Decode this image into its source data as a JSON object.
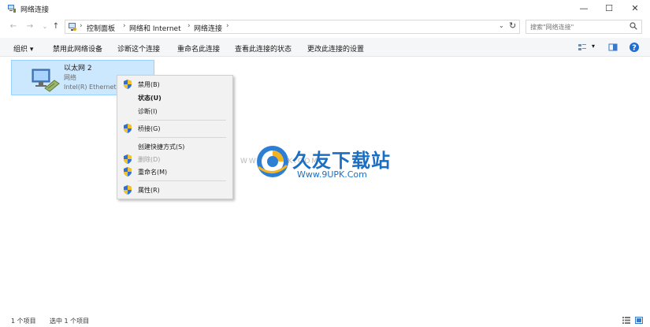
{
  "window": {
    "title": "网络连接",
    "minimize": "—",
    "maximize": "☐",
    "close": "✕"
  },
  "nav": {
    "back": "←",
    "forward": "→",
    "recent": "⌄",
    "up": "↑"
  },
  "address": {
    "crumbs": [
      "控制面板",
      "网络和 Internet",
      "网络连接"
    ],
    "separator": "›",
    "dropdown": "⌄",
    "refresh": "↻"
  },
  "search": {
    "placeholder": "搜索\"网络连接\""
  },
  "toolbar": {
    "organize": "组织 ▾",
    "disable": "禁用此网络设备",
    "diagnose": "诊断这个连接",
    "rename": "重命名此连接",
    "view_status": "查看此连接的状态",
    "change_settings": "更改此连接的设置",
    "view_options_arrow": "▾",
    "help": "?"
  },
  "connection": {
    "name": "以太网 2",
    "status": "网络",
    "adapter": "Intel(R) Ethernet"
  },
  "context_menu": {
    "disable": "禁用(B)",
    "status": "状态(U)",
    "diagnose": "诊断(I)",
    "bridge": "桥接(G)",
    "shortcut": "创建快捷方式(S)",
    "delete": "删除(D)",
    "rename": "重命名(M)",
    "properties": "属性(R)"
  },
  "watermark": {
    "title": "久友下载站",
    "url": "Www.9UPK.Com",
    "faint": "WWW.9UPK.COM"
  },
  "statusbar": {
    "item_count": "1 个项目",
    "selected": "选中 1 个项目"
  },
  "colors": {
    "selection_bg": "#cce8ff",
    "selection_border": "#99d1ff",
    "accent": "#1a6fc2",
    "shield_blue": "#2f6fd6",
    "shield_yellow": "#f2c12e"
  }
}
